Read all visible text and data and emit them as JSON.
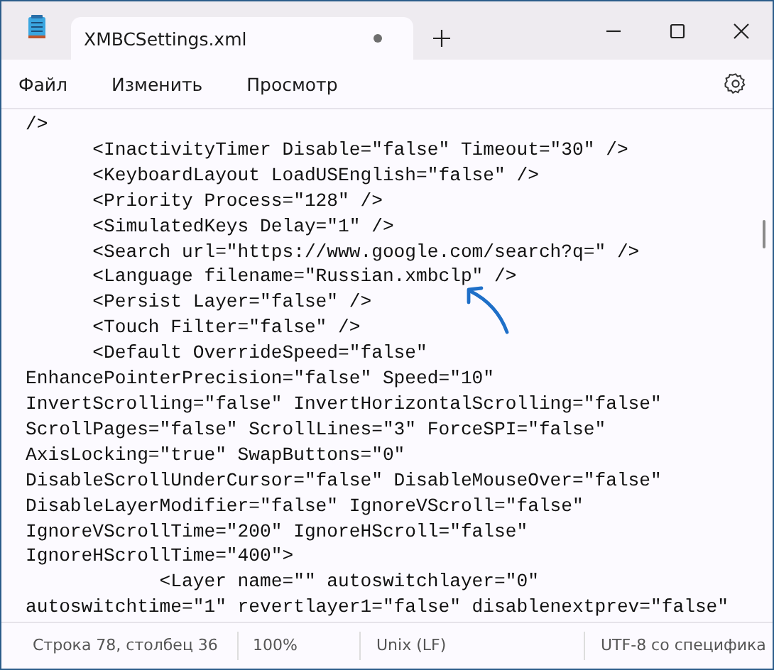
{
  "window": {
    "tab_title": "XMBCSettings.xml",
    "modified": true
  },
  "menu": [
    "Файл",
    "Изменить",
    "Просмотр"
  ],
  "editor": {
    "lines": [
      "/>",
      "      <InactivityTimer Disable=\"false\" Timeout=\"30\" />",
      "      <KeyboardLayout LoadUSEnglish=\"false\" />",
      "      <Priority Process=\"128\" />",
      "      <SimulatedKeys Delay=\"1\" />",
      "      <Search url=\"https://www.google.com/search?q=\" />",
      "      <Language filename=\"Russian.xmbclp\" />",
      "      <Persist Layer=\"false\" />",
      "      <Touch Filter=\"false\" />",
      "      <Default OverrideSpeed=\"false\"",
      "EnhancePointerPrecision=\"false\" Speed=\"10\"",
      "InvertScrolling=\"false\" InvertHorizontalScrolling=\"false\"",
      "ScrollPages=\"false\" ScrollLines=\"3\" ForceSPI=\"false\"",
      "AxisLocking=\"true\" SwapButtons=\"0\"",
      "DisableScrollUnderCursor=\"false\" DisableMouseOver=\"false\"",
      "DisableLayerModifier=\"false\" IgnoreVScroll=\"false\"",
      "IgnoreVScrollTime=\"200\" IgnoreHScroll=\"false\"",
      "IgnoreHScrollTime=\"400\">",
      "            <Layer name=\"\" autoswitchlayer=\"0\"",
      "autoswitchtime=\"1\" revertlayer1=\"false\" disablenextprev=\"false\""
    ]
  },
  "status_bar": [
    "Строка 78, столбец 36",
    "100%",
    "Unix (LF)",
    "UTF-8 со специфика"
  ]
}
